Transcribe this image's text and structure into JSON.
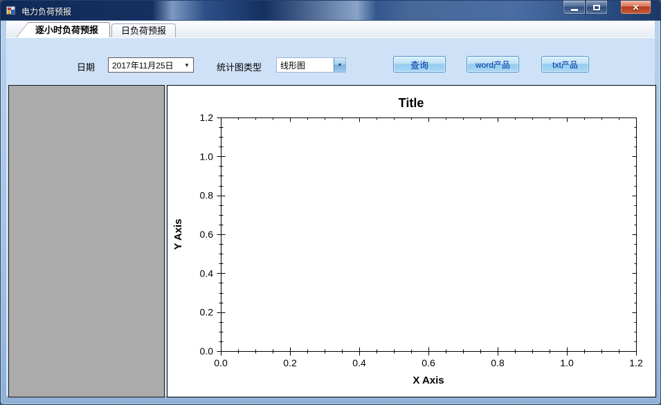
{
  "window": {
    "title": "电力负荷预报",
    "controls": [
      {
        "name": "minimize"
      },
      {
        "name": "maximize"
      },
      {
        "name": "close",
        "glyph": "✕"
      }
    ]
  },
  "tabs": [
    {
      "label": "逐小时负荷预报",
      "selected": true
    },
    {
      "label": "日负荷预报",
      "selected": false
    }
  ],
  "toolbar": {
    "date_label": "日期",
    "date_value": "2017年11月25日",
    "dropdown_arrow": "▼",
    "chart_type_label": "统计图类型",
    "chart_type_value": "线形图",
    "buttons": [
      {
        "label": "查询"
      },
      {
        "label": "word产品"
      },
      {
        "label": "txt产品"
      }
    ]
  },
  "chart_data": {
    "type": "line",
    "title": "Title",
    "xlabel": "X Axis",
    "ylabel": "Y Axis",
    "xlim": [
      0,
      1.2
    ],
    "ylim": [
      0,
      1.2
    ],
    "x_major_step": 0.2,
    "x_minor_step": 0.05,
    "y_major_step": 0.2,
    "y_minor_step": 0.05,
    "x_tick_labels": [
      "0.0",
      "0.2",
      "0.4",
      "0.6",
      "0.8",
      "1.0",
      "1.2"
    ],
    "y_tick_labels": [
      "0.0",
      "0.2",
      "0.4",
      "0.6",
      "0.8",
      "1.0",
      "1.2"
    ],
    "grid": false,
    "legend": false,
    "series": []
  },
  "colors": {
    "page_bg": "#cfe1f7",
    "titlebar": "#16305f",
    "panel_gray": "#ababab",
    "button_border": "#4f94cd",
    "button_text": "#0033a0",
    "chart_fg": "#000000",
    "chart_bg": "#ffffff"
  }
}
